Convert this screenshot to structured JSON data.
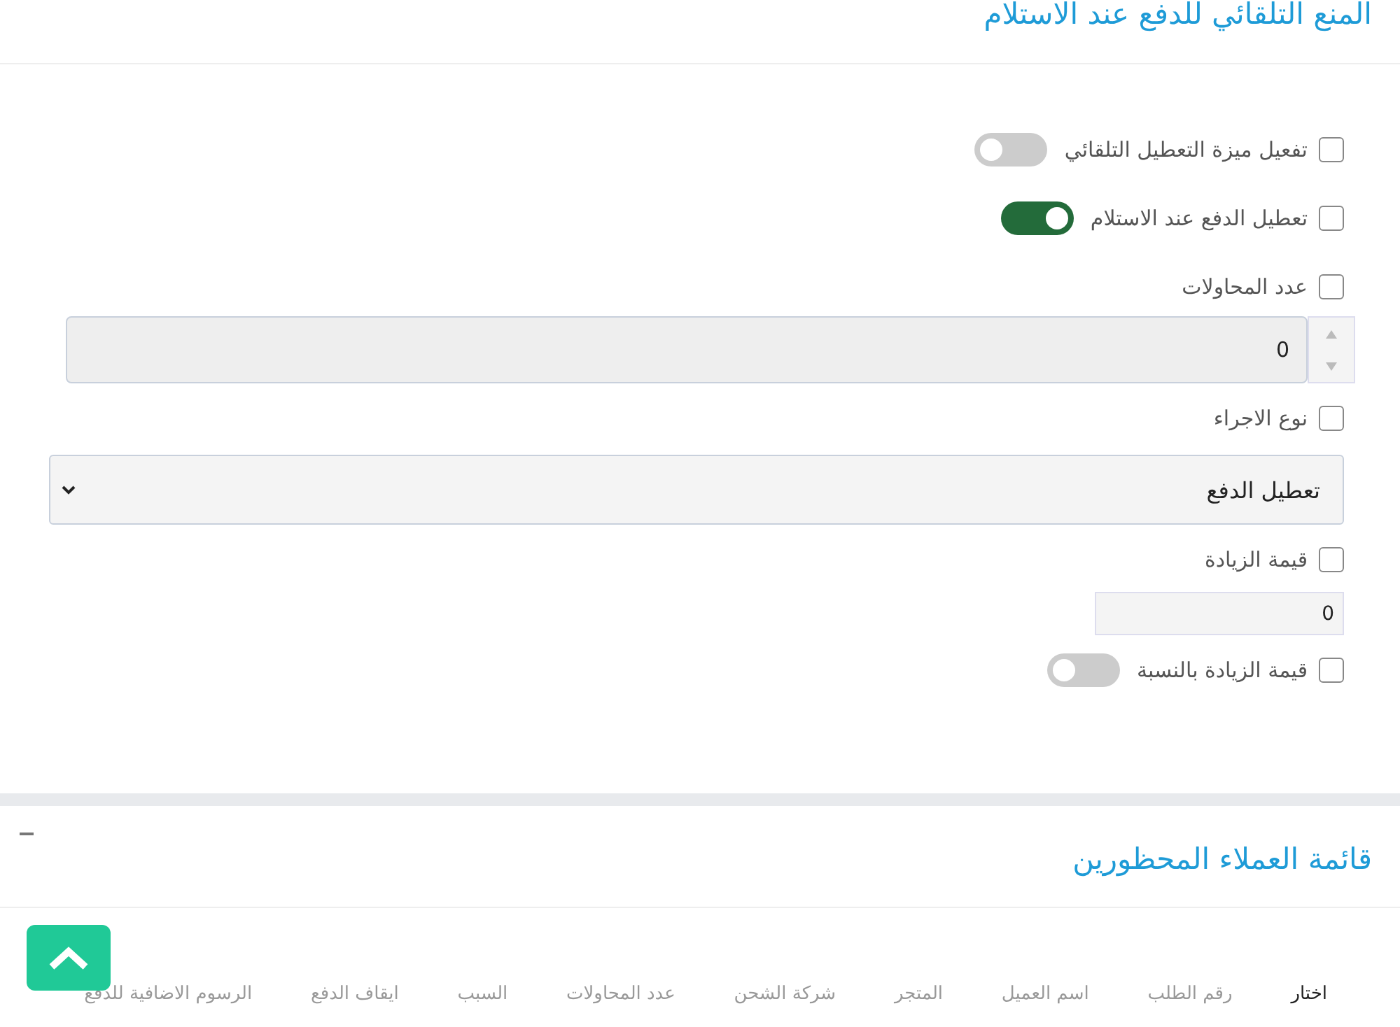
{
  "auto_block": {
    "title": "المنع التلقائي للدفع عند الاستلام",
    "fields": [
      {
        "kind": "check",
        "label": "تفعيل ميزة التعطيل التلقائي",
        "checked": false,
        "switch_on": false
      },
      {
        "kind": "check",
        "label": "تعطيل الدفع عند الاستلام",
        "checked": false,
        "switch_on": true
      },
      {
        "kind": "check",
        "label": "عدد المحاولات",
        "checked": false
      },
      {
        "kind": "spinner",
        "value": "0"
      },
      {
        "kind": "check",
        "label": "نوع الاجراء",
        "checked": false
      },
      {
        "kind": "select",
        "value": "تعطيل الدفع"
      },
      {
        "kind": "check",
        "label": "قيمة الزيادة",
        "checked": false
      },
      {
        "kind": "input",
        "value": "0"
      },
      {
        "kind": "check",
        "label": "قيمة الزيادة بالنسبة",
        "checked": false,
        "switch_on": false
      }
    ]
  },
  "blocked_customers": {
    "title": "قائمة العملاء المحظورين",
    "table": {
      "columns": [
        "اختار",
        "رقم الطلب",
        "اسم العميل",
        "المتجر",
        "شركة الشحن",
        "عدد المحاولات",
        "السبب",
        "ايقاف الدفع",
        "الرسوم الاضافية للدفع"
      ]
    }
  }
}
